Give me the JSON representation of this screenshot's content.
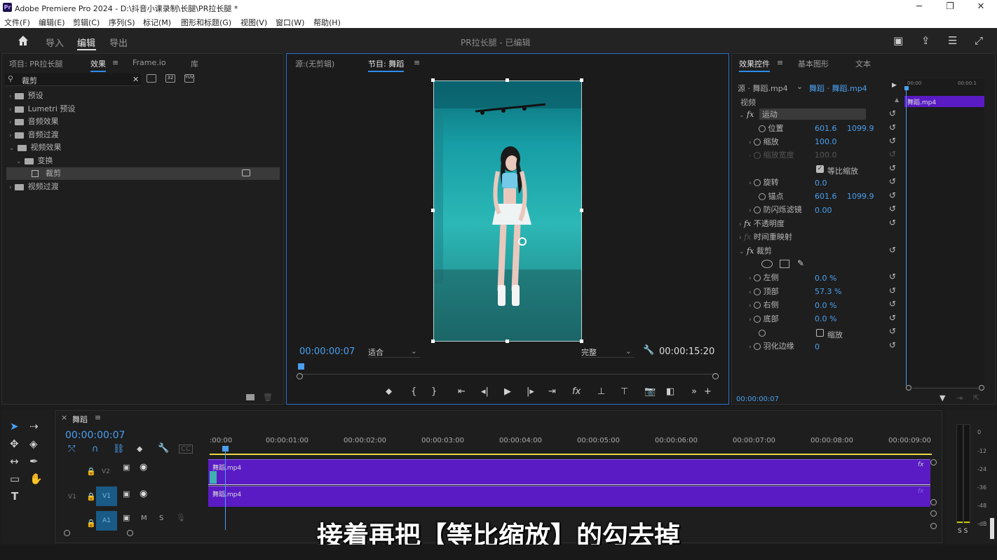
{
  "app": {
    "title": "Adobe Premiere Pro 2024 - D:\\抖音小课录制\\长腿\\PR拉长腿 *",
    "logo": "Pr"
  },
  "menu": [
    "文件(F)",
    "编辑(E)",
    "剪辑(C)",
    "序列(S)",
    "标记(M)",
    "图形和标题(G)",
    "视图(V)",
    "窗口(W)",
    "帮助(H)"
  ],
  "workspaces": {
    "import": "导入",
    "edit": "编辑",
    "export": "导出"
  },
  "project_title": "PR拉长腿 - 已编辑",
  "left_panel": {
    "tabs": [
      "项目: PR拉长腿",
      "效果",
      "Frame.io",
      "库"
    ],
    "search_value": "裁剪",
    "tree": [
      {
        "label": "预设",
        "expanded": false
      },
      {
        "label": "Lumetri 预设",
        "expanded": false
      },
      {
        "label": "音频效果",
        "expanded": false
      },
      {
        "label": "音频过渡",
        "expanded": false
      },
      {
        "label": "视频效果",
        "expanded": true
      },
      {
        "label": "变换",
        "expanded": true
      },
      {
        "label": "裁剪",
        "selected": true
      },
      {
        "label": "视频过渡",
        "expanded": false
      }
    ]
  },
  "monitor": {
    "source_tab": "源:(无剪辑)",
    "program_tab": "节目: 舞蹈",
    "timecode": "00:00:00:07",
    "fit": "适合",
    "quality": "完整",
    "duration": "00:00:15:20"
  },
  "effect_controls": {
    "tabs": [
      "效果控件",
      "基本图形",
      "文本"
    ],
    "source": "源 · 舞蹈.mp4",
    "sequence": "舞蹈 · 舞蹈.mp4",
    "mini_timeline": {
      "t0": "00:00",
      "t1": "00:00:1",
      "clip": "舞蹈.mp4"
    },
    "video_label": "视频",
    "motion": "运动",
    "position_label": "位置",
    "position_x": "601.6",
    "position_y": "1099.9",
    "scale_label": "缩放",
    "scale_value": "100.0",
    "scale_width_label": "缩放宽度",
    "scale_width_value": "100.0",
    "uniform_label": "等比缩放",
    "rotation_label": "旋转",
    "rotation_value": "0.0",
    "anchor_label": "锚点",
    "anchor_x": "601.6",
    "anchor_y": "1099.9",
    "flicker_label": "防闪烁滤镜",
    "flicker_value": "0.00",
    "opacity": "不透明度",
    "time_remap": "时间重映射",
    "crop": "裁剪",
    "left_label": "左侧",
    "left_value": "0.0 %",
    "top_label": "顶部",
    "top_value": "57.3 %",
    "right_label": "右侧",
    "right_value": "0.0 %",
    "bottom_label": "底部",
    "bottom_value": "0.0 %",
    "zoom_label": "缩放",
    "feather_label": "羽化边缘",
    "feather_value": "0",
    "footer_tc": "00:00:00:07"
  },
  "timeline": {
    "seq_name": "舞蹈",
    "timecode": "00:00:00:07",
    "ruler": [
      ":00:00",
      "00:00:01:00",
      "00:00:02:00",
      "00:00:03:00",
      "00:00:04:00",
      "00:00:05:00",
      "00:00:06:00",
      "00:00:07:00",
      "00:00:08:00",
      "00:00:09:00"
    ],
    "tracks": {
      "v2": "V2",
      "v1": "V1",
      "a1": "A1",
      "v1_src": "V1",
      "m": "M",
      "s": "S"
    },
    "clip_v2": "舞蹈.mp4",
    "clip_v1": "舞蹈.mp4",
    "fx": "fx"
  },
  "meter": {
    "labels": [
      "0",
      "-12",
      "-24",
      "-36",
      "-48",
      "-dB"
    ],
    "bottom": "S S"
  },
  "subtitle": "接着再把【等比缩放】的勾去掉"
}
